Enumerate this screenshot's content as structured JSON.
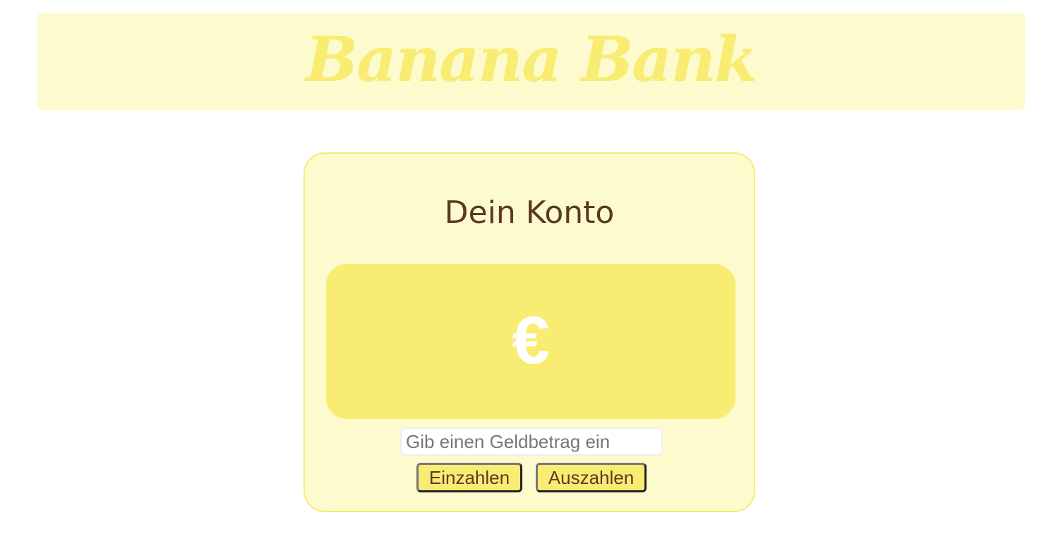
{
  "header": {
    "title": "Banana Bank"
  },
  "account": {
    "title": "Dein Konto",
    "balance": "€",
    "amount_input": {
      "value": "",
      "placeholder": "Gib einen Geldbetrag ein"
    },
    "deposit_label": "Einzahlen",
    "withdraw_label": "Auszahlen"
  },
  "colors": {
    "header_bg": "#fdfacd",
    "accent_yellow": "#f8ec72",
    "text_brown": "#5a3a22",
    "balance_text": "#ffffff"
  }
}
